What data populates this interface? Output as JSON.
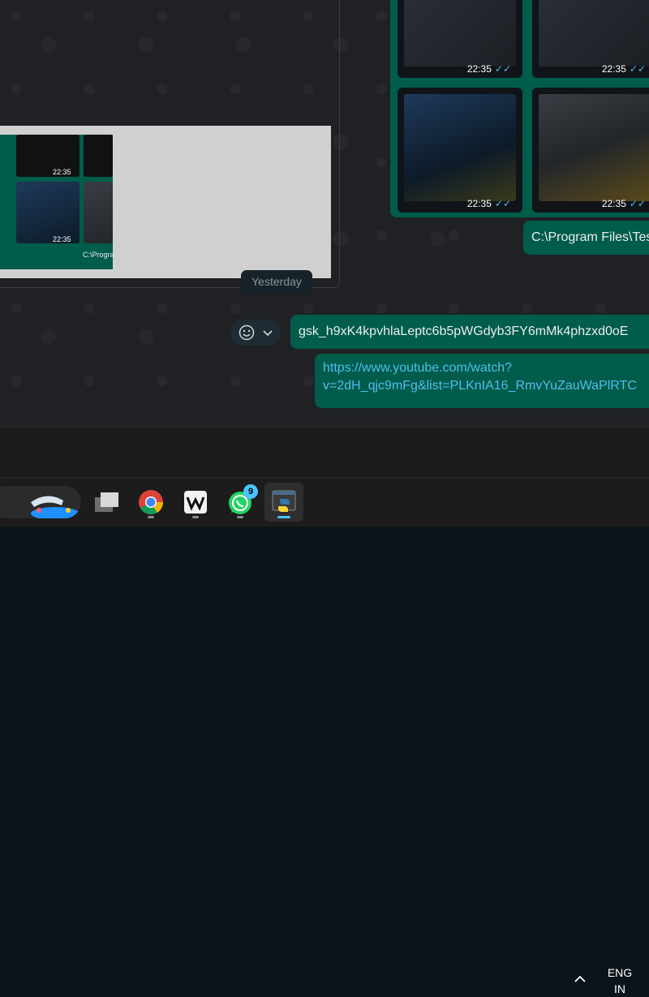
{
  "chat": {
    "thumbnails": [
      {
        "time": "22:35"
      },
      {
        "time": "22:35"
      },
      {
        "time": "22:35"
      },
      {
        "time": "22:35"
      }
    ],
    "path_message": "C:\\Program Files\\Tesseract-OCR",
    "preview": {
      "mini_times": [
        "22:35",
        "22:35"
      ],
      "mini_path": "C:\\Progra"
    },
    "day_separator": "Yesterday",
    "messages": [
      {
        "text": "gsk_h9xK4kpvhlaLeptc6b5pWGdyb3FY6mMk4phzxd0oE"
      },
      {
        "line1": "https://www.youtube.com/watch?",
        "line2": "v=2dH_qjc9mFg&list=PLKnIA16_RmvYuZauWaPlRTC"
      }
    ]
  },
  "taskbar": {
    "apps": [
      {
        "name": "task-view"
      },
      {
        "name": "chrome"
      },
      {
        "name": "wondershare"
      },
      {
        "name": "whatsapp",
        "badge": "9"
      },
      {
        "name": "python-idle"
      }
    ],
    "lang_line1": "ENG",
    "lang_line2": "IN"
  },
  "colors": {
    "bubble_out": "#005c4b",
    "link": "#53bdeb",
    "accent": "#4cc2ff"
  }
}
